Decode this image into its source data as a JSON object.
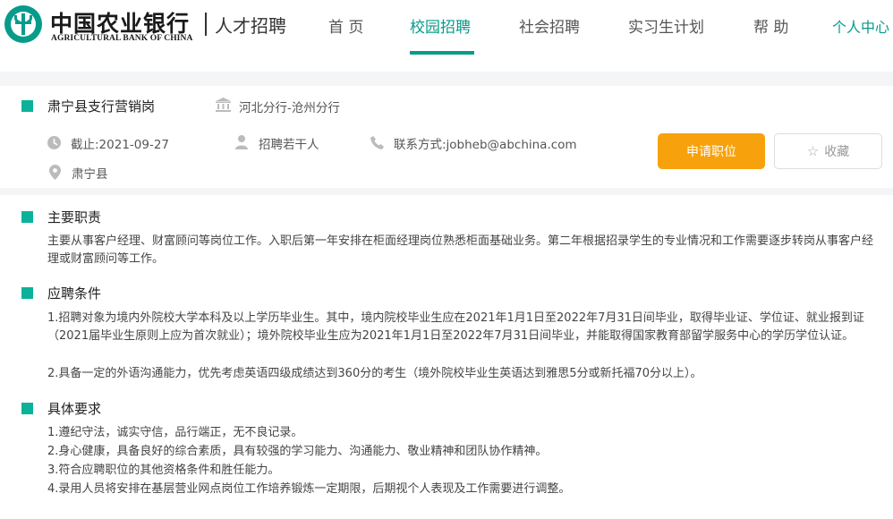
{
  "brand": {
    "cn_name": "中国农业银行",
    "en_name": "AGRICULTURAL BANK OF CHINA",
    "subtitle": "人才招聘"
  },
  "nav": {
    "items": [
      {
        "label": "首 页"
      },
      {
        "label": "校园招聘"
      },
      {
        "label": "社会招聘"
      },
      {
        "label": "实习生计划"
      },
      {
        "label": "帮 助"
      }
    ],
    "active_index": 1,
    "user_center": "个人中心"
  },
  "job": {
    "title": "肃宁县支行营销岗",
    "branch": "河北分行-沧州分行",
    "deadline": "截止:2021-09-27",
    "headcount": "招聘若干人",
    "contact": "联系方式:jobheb@abchina.com",
    "location": "肃宁县",
    "apply_label": "申请职位",
    "favorite_label": "收藏"
  },
  "sections": {
    "duties": {
      "title": "主要职责",
      "text": "主要从事客户经理、财富顾问等岗位工作。入职后第一年安排在柜面经理岗位熟悉柜面基础业务。第二年根据招录学生的专业情况和工作需要逐步转岗从事客户经理或财富顾问等工作。"
    },
    "requirements": {
      "title": "应聘条件",
      "lines": [
        "1.招聘对象为境内外院校大学本科及以上学历毕业生。其中，境内院校毕业生应在2021年1月1日至2022年7月31日间毕业，取得毕业证、学位证、就业报到证（2021届毕业生原则上应为首次就业）；境外院校毕业生应为2021年1月1日至2022年7月31日间毕业，并能取得国家教育部留学服务中心的学历学位认证。",
        "2.具备一定的外语沟通能力，优先考虑英语四级成绩达到360分的考生（境外院校毕业生英语达到雅思5分或新托福70分以上）。"
      ]
    },
    "specifics": {
      "title": "具体要求",
      "lines": [
        "1.遵纪守法，诚实守信，品行端正，无不良记录。",
        "2.身心健康，具备良好的综合素质，具有较强的学习能力、沟通能力、敬业精神和团队协作精神。",
        "3.符合应聘职位的其他资格条件和胜任能力。",
        "4.录用人员将安排在基层营业网点岗位工作培养锻炼一定期限，后期视个人表现及工作需要进行调整。"
      ]
    }
  },
  "colors": {
    "brand_green": "#079b8b",
    "section_marker": "#0ab29a",
    "apply_orange": "#f7a20c"
  },
  "icons": {
    "branch": "bank-icon",
    "deadline": "clock-icon",
    "headcount": "person-icon",
    "contact": "phone-icon",
    "location": "location-pin-icon",
    "favorite": "star-icon"
  }
}
